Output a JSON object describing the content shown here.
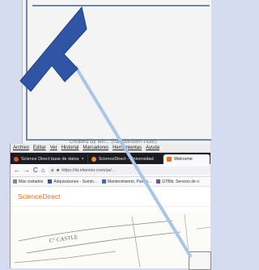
{
  "caption": "created by wh... (handwritten note)",
  "menu": [
    "Archivo",
    "Editar",
    "Ver",
    "Historial",
    "Marcadores",
    "Herramientas",
    "Ayuda"
  ],
  "tabs": [
    {
      "label": "Science Direct base de datos",
      "color": "#e44d26"
    },
    {
      "label": "ScienceDirect - Universidad",
      "color": "#f28c28"
    },
    {
      "label": "Welcome",
      "color": "#e9711c"
    }
  ],
  "toolbar": {
    "back": "←",
    "forward": "→",
    "reload": "C",
    "home": "⌂",
    "url": "https://id.elsevier.com/as/..."
  },
  "bookmarks": [
    {
      "label": "Más visitados",
      "color": "#888888"
    },
    {
      "label": "Adquisiciones - Sumin...",
      "color": "#2b579a"
    },
    {
      "label": "Mantenimiento, Partes...",
      "color": "#3c6fb0"
    },
    {
      "label": "GTBib. Servicio de o",
      "color": "#6c4fa3"
    }
  ],
  "site": {
    "name": "ScienceDirect",
    "accent": "#e9711c"
  },
  "map": {
    "street_label": "C° CASTLE"
  },
  "colors": {
    "arrow_dark": "#2f55a4",
    "arrow_light": "#a9c6e8"
  }
}
